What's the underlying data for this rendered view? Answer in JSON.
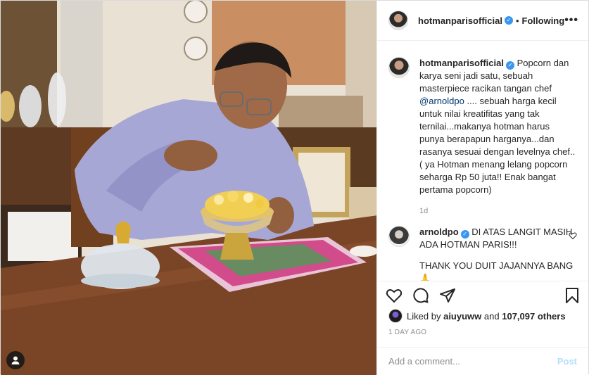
{
  "post": {
    "username": "hotmanparisofficial",
    "follow_status": "Following",
    "separator": "•",
    "more_label": "•••",
    "caption": {
      "username": "hotmanparisofficial",
      "part1": "Popcorn dan karya seni jadi satu, sebuah masterpiece racikan tangan chef ",
      "mention": "@arnoldpo",
      "part2": " .... sebuah harga kecil untuk nilai kreatifitas yang tak ternilai...makanya hotman harus punya berapapun harganya...dan rasanya sesuai dengan levelnya chef..( ya Hotman menang lelang popcorn seharga Rp 50 juta!! Enak bangat pertama popcorn)",
      "time": "1d"
    },
    "comments": [
      {
        "username": "arnoldpo",
        "line1": "DI ATAS LANGIT MASIH ADA HOTMAN PARIS!!!",
        "line2": "THANK YOU DUIT JAJANNYA BANG 🙏"
      }
    ],
    "likes": {
      "prefix": "Liked by ",
      "user": "aiuyuww",
      "middle": " and ",
      "count": "107,097 others"
    },
    "date": "1 DAY AGO",
    "add_comment_placeholder": "Add a comment...",
    "post_button": "Post"
  },
  "icons": {
    "verified": "verified-badge-icon",
    "heart": "heart-icon",
    "comment": "comment-icon",
    "share": "share-icon",
    "save": "bookmark-icon",
    "tag": "user-tag-icon"
  },
  "colors": {
    "verified": "#3897f0",
    "link": "#00376b",
    "muted": "#8e8e8e",
    "post_button": "#b2dffc"
  }
}
